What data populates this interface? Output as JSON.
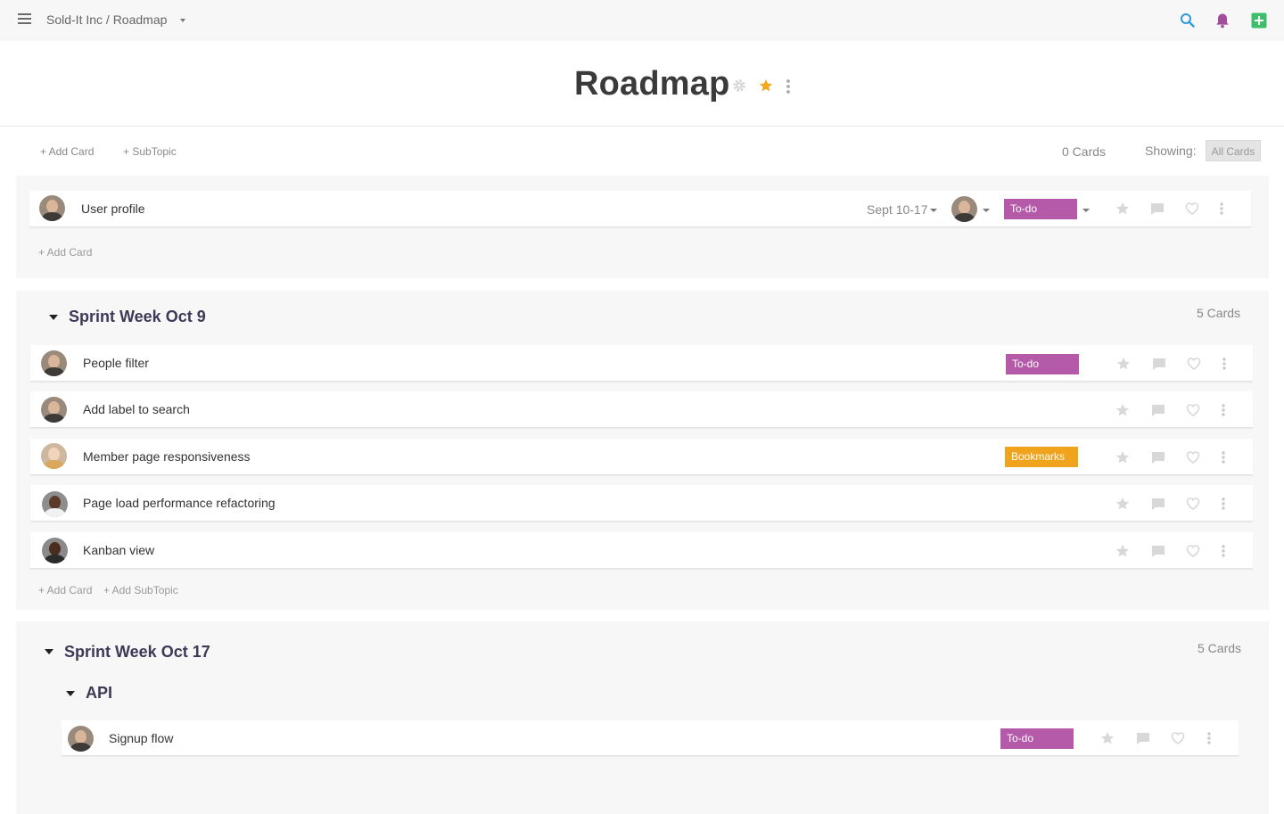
{
  "topbar": {
    "breadcrumb": "Sold-It Inc / Roadmap",
    "icons": [
      "menu-icon",
      "search-icon",
      "bell-icon",
      "add-square-icon"
    ]
  },
  "page": {
    "title": "Roadmap",
    "title_icons": [
      "gear-icon",
      "star-icon",
      "more-vertical-icon"
    ]
  },
  "toolbar": {
    "add_card": "+ Add Card",
    "subtopic": "+ SubTopic",
    "cards_count": "0 Cards",
    "showing_label": "Showing:",
    "filter_value": "All Cards"
  },
  "top_section": {
    "card": {
      "label": "User profile",
      "date_range": "Sept 10-17",
      "status": "To-do"
    },
    "add_card": "+ Add Card"
  },
  "sprint1": {
    "title": "Sprint Week Oct 9",
    "count": "5 Cards",
    "cards": [
      {
        "label": "People filter",
        "status": "To-do"
      },
      {
        "label": "Add label to search",
        "status": ""
      },
      {
        "label": "Member page responsiveness",
        "status": "Bookmarks"
      },
      {
        "label": "Page load performance refactoring",
        "status": ""
      },
      {
        "label": "Kanban view",
        "status": ""
      }
    ],
    "add_card": "+ Add Card",
    "add_subtopic": "+ Add SubTopic"
  },
  "sprint2": {
    "title": "Sprint Week Oct 17",
    "count": "5 Cards",
    "subtopic": {
      "title": "API",
      "cards": [
        {
          "label": "Signup flow",
          "status": "To-do"
        }
      ]
    }
  },
  "colors": {
    "todo": "#b45aa8",
    "bookmarks": "#f0a31c",
    "search": "#2d9cdb",
    "bell": "#a24d9b",
    "add": "#3fbe6b",
    "star_active": "#f2a81d"
  }
}
